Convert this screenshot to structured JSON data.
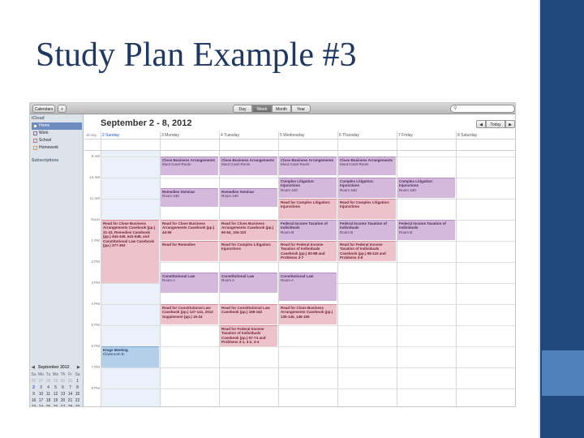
{
  "slide": {
    "title": "Study Plan Example #3"
  },
  "toolbar": {
    "calendars_label": "Calendars",
    "add_label": "+",
    "views": [
      {
        "label": "Day",
        "active": false
      },
      {
        "label": "Week",
        "active": true
      },
      {
        "label": "Month",
        "active": false
      },
      {
        "label": "Year",
        "active": false
      }
    ],
    "search_placeholder": ""
  },
  "sidebar": {
    "account_header": "iCloud",
    "subscriptions_header": "Subscriptions",
    "calendars": [
      {
        "label": "Home",
        "checked": true,
        "selected": true,
        "color": "#5b8fd6"
      },
      {
        "label": "Work",
        "checked": true,
        "selected": false,
        "color": "#9b59b6"
      },
      {
        "label": "School",
        "checked": true,
        "selected": false,
        "color": "#d96a7e"
      },
      {
        "label": "Homework",
        "checked": true,
        "selected": false,
        "color": "#e3a03a"
      }
    ]
  },
  "mini_calendar": {
    "title": "September 2012",
    "prev": "◀",
    "next": "▶",
    "weekdays": [
      "Su",
      "Mo",
      "Tu",
      "We",
      "Th",
      "Fr",
      "Sa"
    ],
    "weeks": [
      [
        "26",
        "27",
        "28",
        "29",
        "30",
        "31",
        "1"
      ],
      [
        "2",
        "3",
        "4",
        "5",
        "6",
        "7",
        "8"
      ],
      [
        "9",
        "10",
        "11",
        "12",
        "13",
        "14",
        "15"
      ],
      [
        "16",
        "17",
        "18",
        "19",
        "20",
        "21",
        "22"
      ],
      [
        "23",
        "24",
        "25",
        "26",
        "27",
        "28",
        "29"
      ],
      [
        "30",
        "1",
        "2",
        "3",
        "4",
        "5",
        "6"
      ]
    ]
  },
  "calendar": {
    "title": "September 2 - 8, 2012",
    "nav": {
      "prev": "◀",
      "today": "Today",
      "next": "▶"
    },
    "all_day_label": "all-day",
    "days": [
      {
        "label": "2 Sunday",
        "today": true
      },
      {
        "label": "3 Monday",
        "today": false
      },
      {
        "label": "4 Tuesday",
        "today": false
      },
      {
        "label": "5 Wednesday",
        "today": false
      },
      {
        "label": "6 Thursday",
        "today": false
      },
      {
        "label": "7 Friday",
        "today": false
      },
      {
        "label": "8 Saturday",
        "today": false
      }
    ],
    "hours": [
      "9 AM",
      "10 AM",
      "11 AM",
      "Noon",
      "1 PM",
      "2 PM",
      "3 PM",
      "4 PM",
      "5 PM",
      "6 PM",
      "7 PM",
      "8 PM"
    ],
    "events": [
      {
        "day": 1,
        "start": 9.0,
        "end": 9.9,
        "cal": "work",
        "title": "Close Business Arrangements",
        "sub": "Moot Court Room"
      },
      {
        "day": 2,
        "start": 9.0,
        "end": 9.9,
        "cal": "work",
        "title": "Close Business Arrangements",
        "sub": "Moot Court Room"
      },
      {
        "day": 3,
        "start": 9.0,
        "end": 9.9,
        "cal": "work",
        "title": "Close Business Arrangements",
        "sub": "Moot Court Room"
      },
      {
        "day": 4,
        "start": 9.0,
        "end": 9.9,
        "cal": "work",
        "title": "Close Business Arrangements",
        "sub": "Moot Court Room"
      },
      {
        "day": 3,
        "start": 10.0,
        "end": 10.95,
        "cal": "work",
        "title": "Complex Litigation: Injunctions",
        "sub": "Room 440"
      },
      {
        "day": 4,
        "start": 10.0,
        "end": 10.95,
        "cal": "work",
        "title": "Complex Litigation: Injunctions",
        "sub": "Room 440"
      },
      {
        "day": 5,
        "start": 10.0,
        "end": 10.95,
        "cal": "work",
        "title": "Complex Litigation: Injunctions",
        "sub": "Room 440"
      },
      {
        "day": 1,
        "start": 10.5,
        "end": 11.4,
        "cal": "work",
        "title": "Remedies Seminar",
        "sub": "Room 440"
      },
      {
        "day": 2,
        "start": 10.5,
        "end": 11.4,
        "cal": "work",
        "title": "Remedies Seminar",
        "sub": "Room 440"
      },
      {
        "day": 3,
        "start": 11.0,
        "end": 11.95,
        "cal": "school",
        "title": "Read for Complex Litigation: Injunctions",
        "sub": ""
      },
      {
        "day": 4,
        "start": 11.0,
        "end": 11.95,
        "cal": "school",
        "title": "Read for Complex Litigation: Injunctions",
        "sub": ""
      },
      {
        "day": 0,
        "start": 12.0,
        "end": 15.0,
        "cal": "school",
        "title": "Read for Close Business Arrangements Casebook (pp.) 31-43, Remedies Casebook (pp.) 444-446, 641-648, and Constitutional Law Casebook (pp.) 377-393",
        "sub": ""
      },
      {
        "day": 1,
        "start": 12.0,
        "end": 12.95,
        "cal": "school",
        "title": "Read for Close Business Arrangements Casebook (pp.) 44-59",
        "sub": ""
      },
      {
        "day": 2,
        "start": 12.0,
        "end": 12.95,
        "cal": "school",
        "title": "Read for Close Business Arrangements Casebook (pp.) 60-64, 104-110",
        "sub": ""
      },
      {
        "day": 3,
        "start": 12.0,
        "end": 12.95,
        "cal": "work",
        "title": "Federal Income Taxation of Individuals",
        "sub": "Room B"
      },
      {
        "day": 4,
        "start": 12.0,
        "end": 12.95,
        "cal": "work",
        "title": "Federal Income Taxation of Individuals",
        "sub": "Room B"
      },
      {
        "day": 5,
        "start": 12.0,
        "end": 12.95,
        "cal": "work",
        "title": "Federal Income Taxation of Individuals",
        "sub": "Room B"
      },
      {
        "day": 1,
        "start": 13.0,
        "end": 13.95,
        "cal": "school",
        "title": "Read for Remedies",
        "sub": ""
      },
      {
        "day": 2,
        "start": 13.0,
        "end": 13.95,
        "cal": "school",
        "title": "Read for Complex Litigation: Injunctions",
        "sub": ""
      },
      {
        "day": 3,
        "start": 13.0,
        "end": 13.95,
        "cal": "school",
        "title": "Read for Federal Income Taxation of Individuals Casebook (pp.) 83-88 and Problems 3-7",
        "sub": ""
      },
      {
        "day": 4,
        "start": 13.0,
        "end": 13.95,
        "cal": "school",
        "title": "Read for Federal Income Taxation of Individuals Casebook (pp.) 98-115 and Problems 3-8",
        "sub": ""
      },
      {
        "day": 1,
        "start": 14.5,
        "end": 15.45,
        "cal": "work",
        "title": "Constitutional Law",
        "sub": "Room A"
      },
      {
        "day": 2,
        "start": 14.5,
        "end": 15.45,
        "cal": "work",
        "title": "Constitutional Law",
        "sub": "Room A"
      },
      {
        "day": 3,
        "start": 14.5,
        "end": 15.85,
        "cal": "work",
        "title": "Constitutional Law",
        "sub": "Room A"
      },
      {
        "day": 1,
        "start": 16.0,
        "end": 16.95,
        "cal": "school",
        "title": "Read for Constitutional Law Casebook (pp.) 127-141, 2012 Supplement (pp.) 15-24",
        "sub": ""
      },
      {
        "day": 2,
        "start": 16.0,
        "end": 16.95,
        "cal": "school",
        "title": "Read for Constitutional Law Casebook (pp.) 159-162",
        "sub": ""
      },
      {
        "day": 3,
        "start": 16.0,
        "end": 16.95,
        "cal": "school",
        "title": "Read for Close Business Arrangements Casebook (pp.) 135-145, 148-155",
        "sub": ""
      },
      {
        "day": 2,
        "start": 17.0,
        "end": 18.0,
        "cal": "school",
        "title": "Read for Federal Income Taxation of Individuals Casebook (pp.) 57-74 and Problems 3-1, 3-2, 3-4",
        "sub": ""
      },
      {
        "day": 0,
        "start": 18.0,
        "end": 19.0,
        "cal": "home",
        "title": "Kings Meeting",
        "sub": "Classroom B"
      }
    ]
  }
}
